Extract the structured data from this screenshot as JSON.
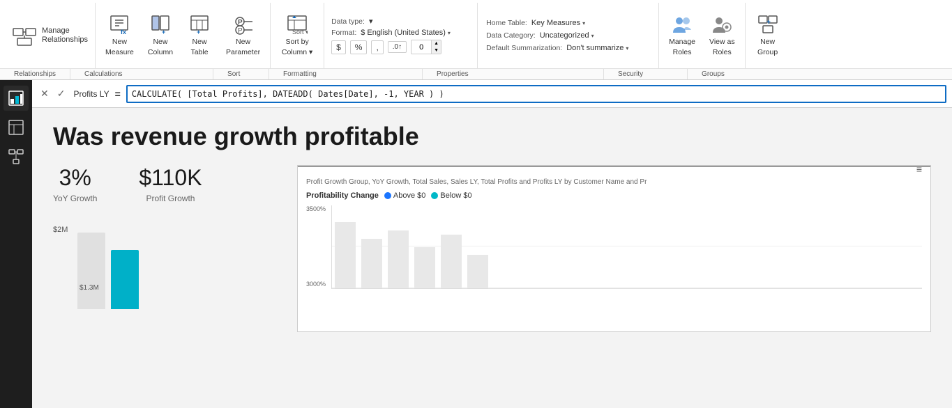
{
  "ribbon": {
    "groups": {
      "relationships": {
        "label": "Manage Relationships",
        "section": "Relationships"
      },
      "calculations": {
        "buttons": [
          {
            "id": "new-measure",
            "label": "New\nMeasure",
            "line1": "New",
            "line2": "Measure"
          },
          {
            "id": "new-column",
            "label": "New\nColumn",
            "line1": "New",
            "line2": "Column"
          },
          {
            "id": "new-table",
            "label": "New\nTable",
            "line1": "New",
            "line2": "Table"
          },
          {
            "id": "new-parameter",
            "label": "New\nParameter",
            "line1": "New",
            "line2": "Parameter"
          }
        ],
        "section": "Calculations"
      },
      "what_if": {
        "buttons": [
          {
            "id": "sort-by-column",
            "label": "Sort by\nColumn",
            "line1": "Sort by",
            "line2": "Column ▾"
          }
        ],
        "section": "Sort"
      },
      "data_type": {
        "label": "Data type:",
        "format_label": "Format:",
        "format_value": "$ English (United States)",
        "symbols": [
          "$",
          "%",
          ",",
          ".00"
        ],
        "number_value": "0",
        "section": "Formatting"
      },
      "properties": {
        "home_table_label": "Home Table:",
        "home_table_value": "Key Measures",
        "data_category_label": "Data Category:",
        "data_category_value": "Uncategorized",
        "default_summarization_label": "Default Summarization:",
        "default_summarization_value": "Don't summarize",
        "section": "Properties"
      },
      "security": {
        "buttons": [
          {
            "id": "manage-roles",
            "label": "Manage\nRoles",
            "line1": "Manage",
            "line2": "Roles"
          },
          {
            "id": "view-as-roles",
            "label": "View as\nRoles",
            "line1": "View as",
            "line2": "Roles"
          }
        ],
        "section": "Security"
      },
      "groups": {
        "buttons": [
          {
            "id": "new-group",
            "label": "New\nGroup",
            "line1": "New",
            "line2": "Group"
          }
        ],
        "section": "Groups"
      }
    }
  },
  "formula_bar": {
    "cancel_label": "✕",
    "confirm_label": "✓",
    "measure_name": "Profits LY",
    "equals": "=",
    "formula": "CALCULATE( [Total Profits], DATEADD( Dates[Date], -1, YEAR ) )"
  },
  "sidebar": {
    "icons": [
      {
        "id": "report-view",
        "label": "Report view",
        "active": true
      },
      {
        "id": "data-view",
        "label": "Data view",
        "active": false
      },
      {
        "id": "model-view",
        "label": "Model view",
        "active": false
      }
    ]
  },
  "main": {
    "title": "Was revenue growth profitable",
    "metrics": [
      {
        "value": "3%",
        "label": "YoY Growth"
      },
      {
        "value": "$110K",
        "label": "Profit Growth"
      }
    ],
    "bar_chart": {
      "y_label_top": "$2M",
      "y_label_bottom": "$1.3M",
      "bars": [
        {
          "height": 90,
          "color": "#00b0c8"
        },
        {
          "height": 70,
          "color": "#00b0c8"
        }
      ]
    },
    "right_panel": {
      "header": "Profit Growth Group, YoY Growth, Total Sales, Sales LY, Total Profits and Profits LY by Customer Name and Pr",
      "legend_title": "Profitability Change",
      "legend_items": [
        {
          "label": "Above $0",
          "color": "#1a75ff"
        },
        {
          "label": "Below $0",
          "color": "#00b8c8"
        }
      ],
      "y_labels": [
        "3500%",
        "3000%"
      ],
      "topbar_icon": "≡"
    }
  }
}
